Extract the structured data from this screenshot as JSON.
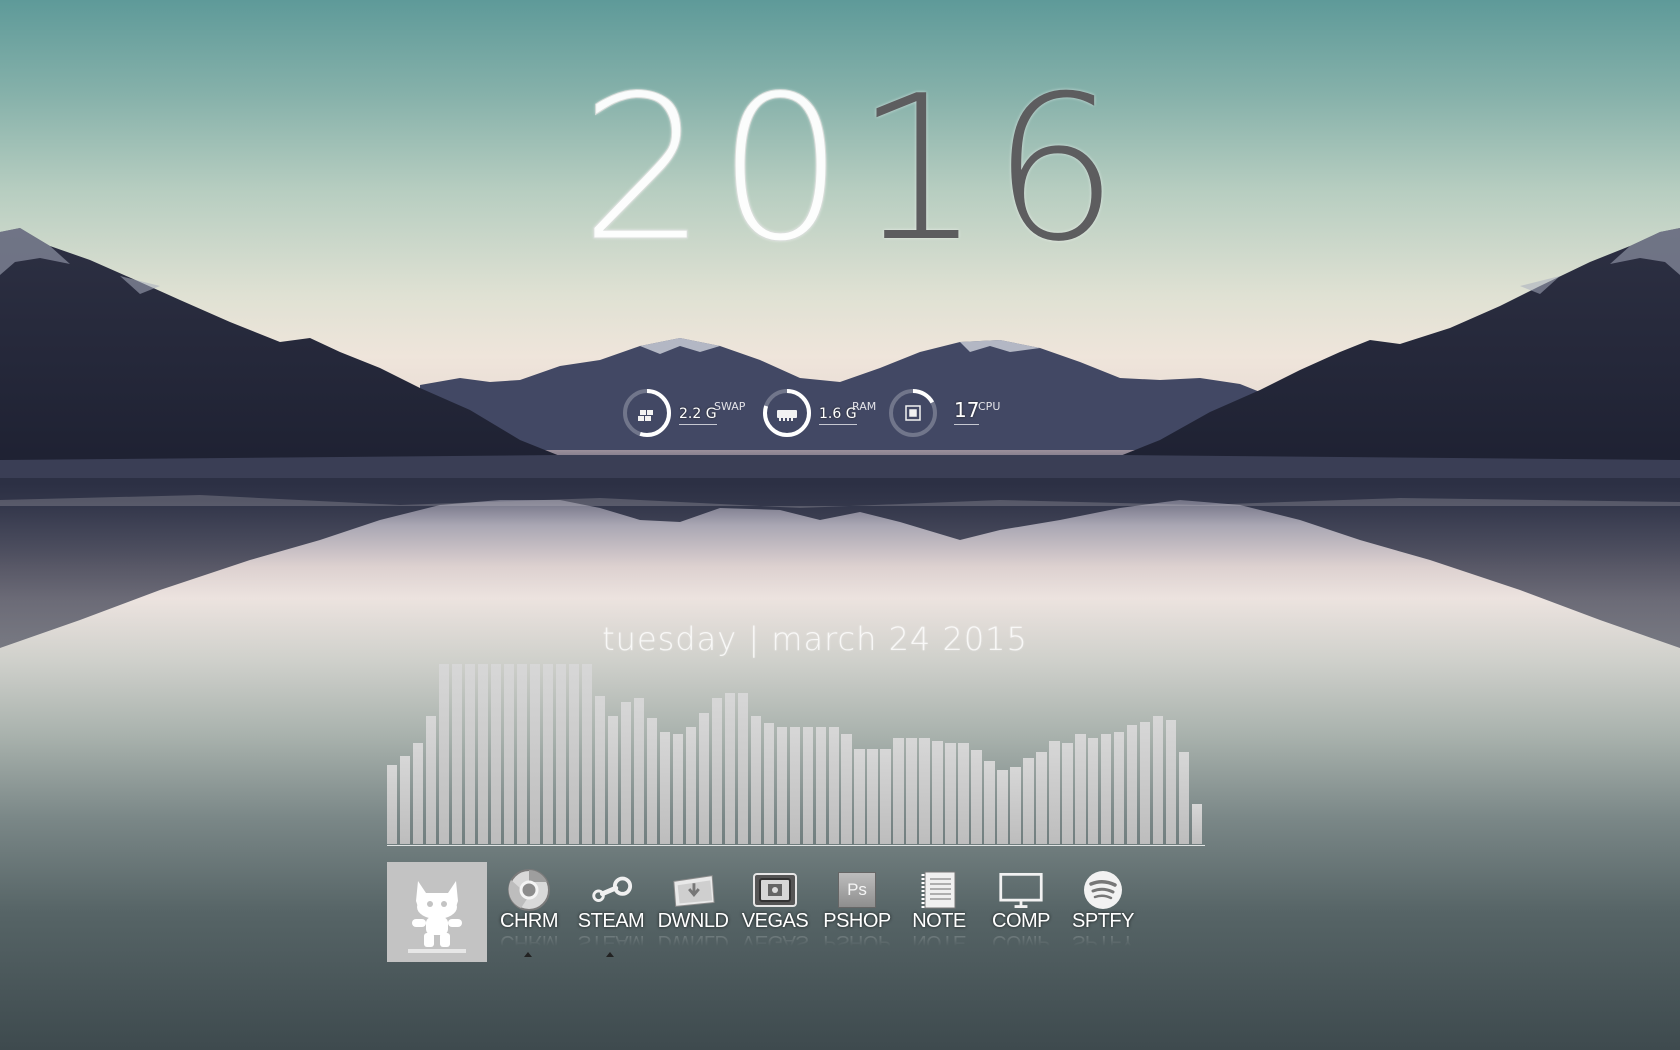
{
  "clock": {
    "year_part1": "20",
    "year_part2": "16"
  },
  "gauges": [
    {
      "id": "swap",
      "icon": "swap-icon",
      "value": "2.2 G",
      "label": "SWAP",
      "fraction": 0.55
    },
    {
      "id": "ram",
      "icon": "ram-icon",
      "value": "1.6 G",
      "label": "RAM",
      "fraction": 0.8
    },
    {
      "id": "cpu",
      "icon": "cpu-icon",
      "value": "17",
      "label": "CPU",
      "fraction": 0.17
    }
  ],
  "date_line": "tuesday | march 24 2015",
  "visualizer": {
    "levels": [
      0.44,
      0.49,
      0.56,
      0.71,
      1,
      1,
      1,
      1,
      1,
      1,
      1,
      1,
      1,
      1,
      1,
      1,
      0.82,
      0.71,
      0.79,
      0.81,
      0.7,
      0.62,
      0.61,
      0.65,
      0.73,
      0.81,
      0.84,
      0.84,
      0.71,
      0.67,
      0.65,
      0.65,
      0.65,
      0.65,
      0.65,
      0.61,
      0.53,
      0.53,
      0.53,
      0.59,
      0.59,
      0.59,
      0.57,
      0.56,
      0.56,
      0.52,
      0.46,
      0.41,
      0.43,
      0.48,
      0.51,
      0.57,
      0.56,
      0.61,
      0.59,
      0.61,
      0.62,
      0.66,
      0.68,
      0.71,
      0.69,
      0.51,
      0.22
    ],
    "accent": "#c4c4c4"
  },
  "dock": {
    "now_playing_icon": "monstercat-icon",
    "launchers": [
      {
        "id": "chrome",
        "label": "CHRM",
        "icon": "chrome-icon",
        "running": true
      },
      {
        "id": "steam",
        "label": "STEAM",
        "icon": "steam-icon",
        "running": true
      },
      {
        "id": "downloads",
        "label": "DWNLD",
        "icon": "downloads-folder-icon",
        "running": false
      },
      {
        "id": "vegas",
        "label": "VEGAS",
        "icon": "vegas-icon",
        "running": false
      },
      {
        "id": "photoshop",
        "label": "PSHOP",
        "icon": "photoshop-icon",
        "icon_text": "Ps",
        "running": false
      },
      {
        "id": "notepad",
        "label": "NOTE",
        "icon": "notepad-icon",
        "running": false
      },
      {
        "id": "computer",
        "label": "COMP",
        "icon": "computer-icon",
        "running": false
      },
      {
        "id": "spotify",
        "label": "SPTFY",
        "icon": "spotify-icon",
        "running": false
      }
    ]
  }
}
